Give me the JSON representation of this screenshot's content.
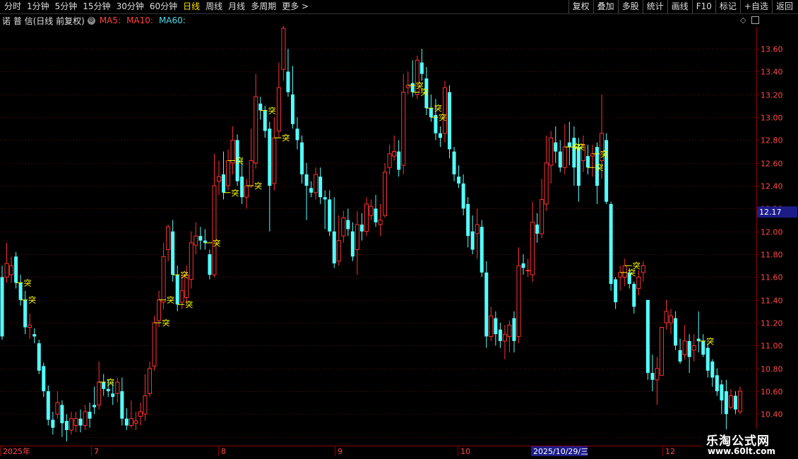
{
  "toolbar": {
    "periods": [
      "分时",
      "1分钟",
      "5分钟",
      "15分钟",
      "30分钟",
      "60分钟",
      "日线",
      "周线",
      "月线",
      "多周期",
      "更多 >"
    ],
    "active_period": "日线",
    "actions": [
      "复权",
      "叠加",
      "多股",
      "统计",
      "画线",
      "F10",
      "标记",
      "+自选",
      "返回"
    ]
  },
  "legend": {
    "stock": "诺 普 信(日线 前复权)",
    "ma5": "MA5:",
    "ma10": "MA10:",
    "ma60": "MA60:"
  },
  "price_label": "12.17",
  "date_labels": [
    "2025年",
    "7",
    "8",
    "9",
    "10",
    "12"
  ],
  "cursor_date": "2025/10/29/三",
  "signal_text": "突",
  "watermark": {
    "name": "乐淘公式网",
    "url": "www.60lt.com"
  },
  "colors": {
    "up": "#ff3232",
    "down": "#54ffff",
    "grid": "#5a1010",
    "axis": "#8b0000",
    "signal": "#ffff00",
    "label_bg": "#1c1c88"
  },
  "chart_data": {
    "type": "candlestick",
    "ylim": [
      10.13,
      13.78
    ],
    "y_ticks": [
      "13.60",
      "13.40",
      "13.20",
      "13.00",
      "12.80",
      "12.60",
      "12.40",
      "12.20",
      "12.00",
      "11.80",
      "11.60",
      "11.40",
      "11.20",
      "11.00",
      "10.80",
      "10.60",
      "10.40",
      "10.20"
    ],
    "candles": [
      [
        11.6,
        11.08,
        11.7,
        11.05
      ],
      [
        11.6,
        11.72,
        11.9,
        11.55
      ],
      [
        11.62,
        11.7,
        11.78,
        11.55
      ],
      [
        11.78,
        11.55,
        11.82,
        11.5
      ],
      [
        11.55,
        11.4,
        11.62,
        11.35
      ],
      [
        11.4,
        11.16,
        11.48,
        11.1
      ],
      [
        11.16,
        11.18,
        11.28,
        11.06
      ],
      [
        11.1,
        11.08,
        11.15,
        11.02
      ],
      [
        11.02,
        10.78,
        11.05,
        10.75
      ],
      [
        10.82,
        10.6,
        10.85,
        10.55
      ],
      [
        10.6,
        10.35,
        10.65,
        10.3
      ],
      [
        10.35,
        10.28,
        10.42,
        10.22
      ],
      [
        10.4,
        10.5,
        10.6,
        10.36
      ],
      [
        10.48,
        10.32,
        10.52,
        10.2
      ],
      [
        10.34,
        10.26,
        10.4,
        10.16
      ],
      [
        10.26,
        10.36,
        10.42,
        10.22
      ],
      [
        10.3,
        10.36,
        10.42,
        10.24
      ],
      [
        10.36,
        10.3,
        10.44,
        10.24
      ],
      [
        10.3,
        10.42,
        10.48,
        10.26
      ],
      [
        10.42,
        10.36,
        10.5,
        10.28
      ],
      [
        10.48,
        10.46,
        10.64,
        10.4
      ],
      [
        10.48,
        10.68,
        10.86,
        10.44
      ],
      [
        10.68,
        10.62,
        10.75,
        10.56
      ],
      [
        10.62,
        10.6,
        10.7,
        10.55
      ],
      [
        10.58,
        10.55,
        10.68,
        10.48
      ],
      [
        10.58,
        10.68,
        10.72,
        10.5
      ],
      [
        10.6,
        10.36,
        10.72,
        10.3
      ],
      [
        10.36,
        10.3,
        10.45,
        10.26
      ],
      [
        10.3,
        10.36,
        10.52,
        10.28
      ],
      [
        10.32,
        10.34,
        10.42,
        10.26
      ],
      [
        10.38,
        10.42,
        10.5,
        10.3
      ],
      [
        10.4,
        10.56,
        10.75,
        10.34
      ],
      [
        10.58,
        10.8,
        10.86,
        10.55
      ],
      [
        10.82,
        11.2,
        11.26,
        10.78
      ],
      [
        11.22,
        11.4,
        11.48,
        11.16
      ],
      [
        11.38,
        11.78,
        11.9,
        11.32
      ],
      [
        11.84,
        12.04,
        12.06,
        11.74
      ],
      [
        12.0,
        11.62,
        12.1,
        11.56
      ],
      [
        11.62,
        11.36,
        11.7,
        11.3
      ],
      [
        11.38,
        11.48,
        11.62,
        11.32
      ],
      [
        11.42,
        11.62,
        11.7,
        11.38
      ],
      [
        11.58,
        11.9,
        12.0,
        11.5
      ],
      [
        11.88,
        11.96,
        12.08,
        11.8
      ],
      [
        11.96,
        11.92,
        12.04,
        11.84
      ],
      [
        11.92,
        11.9,
        12.02,
        11.84
      ],
      [
        11.8,
        11.62,
        11.84,
        11.58
      ],
      [
        11.62,
        12.4,
        12.68,
        11.6
      ],
      [
        12.44,
        12.48,
        12.62,
        12.32
      ],
      [
        12.5,
        12.34,
        12.7,
        12.28
      ],
      [
        12.4,
        12.62,
        12.72,
        12.36
      ],
      [
        12.6,
        12.8,
        12.92,
        12.5
      ],
      [
        12.8,
        12.44,
        12.85,
        12.4
      ],
      [
        12.48,
        12.3,
        12.62,
        12.24
      ],
      [
        12.3,
        12.4,
        12.46,
        12.2
      ],
      [
        12.4,
        12.62,
        12.9,
        12.38
      ],
      [
        12.6,
        13.18,
        13.38,
        12.55
      ],
      [
        13.12,
        13.06,
        13.18,
        12.98
      ],
      [
        13.06,
        12.88,
        13.1,
        12.82
      ],
      [
        12.9,
        12.4,
        12.96,
        12.0
      ],
      [
        12.42,
        12.82,
        13.0,
        12.36
      ],
      [
        12.88,
        13.26,
        13.48,
        12.82
      ],
      [
        13.42,
        13.78,
        13.8,
        13.32
      ],
      [
        13.4,
        13.22,
        13.6,
        13.18
      ],
      [
        13.2,
        12.94,
        13.45,
        12.9
      ],
      [
        12.9,
        12.8,
        13.0,
        12.72
      ],
      [
        12.78,
        12.5,
        12.84,
        12.42
      ],
      [
        12.5,
        12.4,
        12.6,
        12.1
      ],
      [
        12.38,
        12.34,
        12.44,
        12.3
      ],
      [
        12.34,
        12.5,
        12.56,
        12.28
      ],
      [
        12.48,
        12.3,
        12.56,
        12.24
      ],
      [
        12.3,
        12.28,
        12.36,
        12.02
      ],
      [
        12.28,
        12.0,
        12.36,
        11.96
      ],
      [
        12.0,
        11.72,
        12.3,
        11.68
      ],
      [
        11.74,
        11.92,
        12.14,
        11.7
      ],
      [
        11.96,
        12.12,
        12.18,
        11.9
      ],
      [
        12.1,
        12.02,
        12.2,
        11.96
      ],
      [
        12.0,
        11.78,
        12.08,
        11.74
      ],
      [
        11.84,
        12.06,
        12.18,
        11.62
      ],
      [
        12.06,
        12.0,
        12.16,
        11.92
      ],
      [
        12.0,
        12.24,
        12.3,
        11.96
      ],
      [
        12.14,
        12.22,
        12.28,
        12.1
      ],
      [
        12.2,
        12.08,
        12.32,
        12.04
      ],
      [
        12.06,
        12.1,
        12.24,
        11.96
      ],
      [
        12.14,
        12.52,
        12.6,
        12.12
      ],
      [
        12.56,
        12.68,
        12.76,
        12.5
      ],
      [
        12.66,
        12.7,
        12.84,
        12.62
      ],
      [
        12.7,
        12.54,
        12.8,
        12.48
      ],
      [
        12.58,
        13.22,
        13.38,
        12.5
      ],
      [
        13.26,
        13.28,
        13.4,
        13.2
      ],
      [
        13.3,
        13.22,
        13.5,
        13.18
      ],
      [
        13.2,
        13.5,
        13.54,
        13.16
      ],
      [
        13.48,
        13.38,
        13.6,
        13.32
      ],
      [
        13.34,
        13.08,
        13.44,
        13.02
      ],
      [
        13.08,
        13.0,
        13.2,
        12.96
      ],
      [
        13.02,
        12.86,
        13.16,
        12.8
      ],
      [
        12.86,
        12.82,
        12.92,
        12.74
      ],
      [
        12.86,
        13.26,
        13.32,
        12.78
      ],
      [
        13.22,
        12.72,
        13.28,
        12.64
      ],
      [
        12.7,
        12.5,
        12.74,
        12.44
      ],
      [
        12.48,
        12.42,
        12.58,
        12.38
      ],
      [
        12.42,
        12.2,
        12.5,
        12.14
      ],
      [
        12.24,
        11.96,
        12.3,
        11.86
      ],
      [
        12.0,
        11.84,
        12.14,
        11.8
      ],
      [
        11.98,
        12.06,
        12.2,
        11.76
      ],
      [
        12.04,
        11.64,
        12.1,
        11.6
      ],
      [
        11.64,
        11.08,
        11.74,
        10.98
      ],
      [
        11.08,
        11.26,
        11.34,
        11.04
      ],
      [
        11.24,
        11.1,
        11.3,
        11.0
      ],
      [
        11.14,
        11.04,
        11.2,
        10.98
      ],
      [
        11.04,
        11.1,
        11.18,
        10.88
      ],
      [
        11.08,
        11.18,
        11.22,
        10.94
      ],
      [
        11.24,
        11.04,
        11.3,
        10.94
      ],
      [
        11.08,
        11.7,
        11.86,
        11.02
      ],
      [
        11.72,
        11.68,
        11.8,
        11.62
      ],
      [
        11.66,
        11.66,
        11.76,
        11.6
      ],
      [
        11.62,
        12.08,
        12.26,
        11.56
      ],
      [
        12.06,
        11.98,
        12.16,
        11.9
      ],
      [
        11.98,
        12.28,
        12.46,
        11.94
      ],
      [
        12.24,
        12.6,
        12.84,
        12.18
      ],
      [
        12.58,
        12.82,
        12.88,
        12.42
      ],
      [
        12.78,
        12.7,
        12.92,
        12.6
      ],
      [
        12.7,
        12.56,
        12.8,
        12.52
      ],
      [
        12.56,
        12.74,
        12.94,
        12.5
      ],
      [
        12.78,
        12.74,
        12.96,
        12.58
      ],
      [
        12.82,
        12.56,
        12.92,
        12.4
      ],
      [
        12.74,
        12.4,
        12.82,
        12.26
      ],
      [
        12.62,
        12.76,
        12.84,
        12.52
      ],
      [
        12.66,
        12.56,
        12.76,
        12.5
      ],
      [
        12.66,
        12.68,
        12.76,
        12.48
      ],
      [
        12.74,
        12.4,
        12.78,
        12.24
      ],
      [
        12.62,
        12.86,
        13.2,
        12.46
      ],
      [
        12.8,
        12.26,
        12.86,
        12.24
      ],
      [
        12.24,
        11.54,
        12.26,
        11.48
      ],
      [
        11.58,
        11.38,
        11.6,
        11.32
      ],
      [
        11.6,
        11.64,
        11.7,
        11.48
      ],
      [
        11.6,
        11.7,
        11.76,
        11.52
      ],
      [
        11.64,
        11.54,
        11.68,
        11.5
      ],
      [
        11.54,
        11.34,
        11.56,
        11.28
      ],
      [
        11.5,
        11.6,
        11.66,
        11.44
      ],
      [
        11.64,
        11.7,
        11.74,
        11.56
      ],
      [
        11.4,
        10.76,
        11.4,
        10.7
      ],
      [
        10.76,
        10.7,
        10.92,
        10.6
      ],
      [
        10.7,
        10.8,
        10.9,
        10.48
      ],
      [
        10.74,
        11.16,
        11.16,
        10.8
      ],
      [
        11.2,
        11.3,
        11.4,
        11.14
      ],
      [
        11.2,
        11.26,
        11.32,
        11.1
      ],
      [
        11.24,
        11.0,
        11.3,
        10.96
      ],
      [
        10.96,
        10.86,
        11.06,
        10.84
      ],
      [
        10.92,
        11.04,
        11.18,
        10.88
      ],
      [
        11.04,
        10.9,
        11.1,
        10.76
      ],
      [
        10.96,
        11.0,
        11.1,
        10.86
      ],
      [
        11.06,
        11.04,
        11.3,
        10.94
      ],
      [
        11.04,
        10.92,
        11.1,
        10.9
      ],
      [
        10.98,
        10.78,
        11.02,
        10.72
      ],
      [
        10.86,
        10.72,
        10.88,
        10.64
      ],
      [
        10.74,
        10.6,
        10.8,
        10.56
      ],
      [
        10.66,
        10.52,
        10.7,
        10.4
      ],
      [
        10.6,
        10.4,
        10.7,
        10.22
      ],
      [
        10.46,
        10.56,
        10.62,
        10.44
      ],
      [
        10.56,
        10.44,
        10.6,
        10.4
      ],
      [
        10.42,
        10.6,
        10.64,
        10.4
      ]
    ],
    "ma60": [],
    "signals": [
      3,
      4,
      21,
      33,
      34,
      37,
      38,
      44,
      48,
      49,
      53,
      56,
      59,
      88,
      89,
      92,
      93,
      122,
      123,
      127,
      128,
      134,
      135,
      151
    ]
  }
}
